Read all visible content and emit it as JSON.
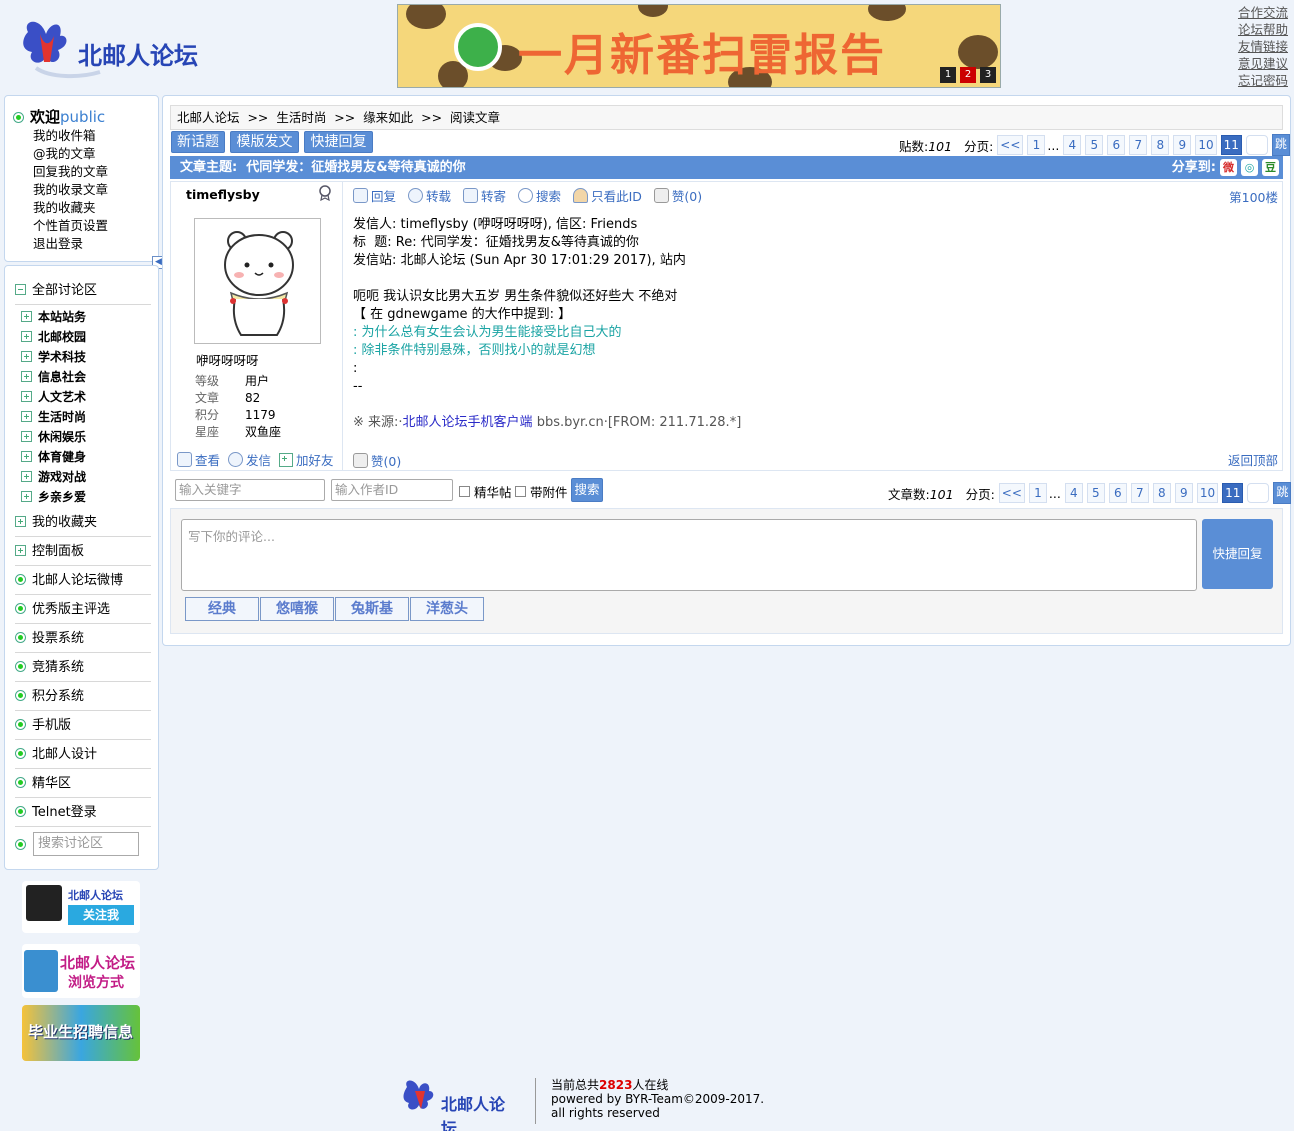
{
  "header": {
    "logo_text": "北邮人论坛",
    "banner_text": "一月新番扫雷报告",
    "banner_pages": [
      "1",
      "2",
      "3"
    ],
    "top_links": [
      "合作交流",
      "论坛帮助",
      "友情链接",
      "意见建议",
      "忘记密码"
    ]
  },
  "welcome": {
    "greeting": "欢迎",
    "user": "public",
    "links": [
      "我的收件箱",
      "@我的文章",
      "回复我的文章",
      "我的收录文章",
      "我的收藏夹",
      "个性首页设置",
      "退出登录"
    ]
  },
  "nav": {
    "all_sections": "全部讨论区",
    "sections": [
      "本站站务",
      "北邮校园",
      "学术科技",
      "信息社会",
      "人文艺术",
      "生活时尚",
      "休闲娱乐",
      "体育健身",
      "游戏对战",
      "乡亲乡爱"
    ],
    "favorites": "我的收藏夹",
    "control_panel": "控制面板",
    "items": [
      "北邮人论坛微博",
      "优秀版主评选",
      "投票系统",
      "竞猜系统",
      "积分系统",
      "手机版",
      "北邮人设计",
      "精华区",
      "Telnet登录"
    ],
    "search_placeholder": "搜索讨论区"
  },
  "side_images": {
    "follow_title": "北邮人论坛",
    "follow_button": "关注我",
    "browse_title": "北邮人论坛",
    "browse_sub": "浏览方式",
    "jobs": "毕业生招聘信息"
  },
  "crumb": "北邮人论坛  >>  生活时尚  >>  缘来如此  >>  阅读文章",
  "actions": {
    "new_topic": "新话题",
    "template_post": "模版发文",
    "quick_reply": "快捷回复"
  },
  "pager": {
    "posts_label": "贴数:",
    "posts_count": "101",
    "articles_label": "文章数:",
    "articles_count": "101",
    "page_label": "分页:",
    "prev": "<<",
    "pages": [
      "1",
      "...",
      "4",
      "5",
      "6",
      "7",
      "8",
      "9",
      "10",
      "11"
    ],
    "current": "11",
    "go": "跳"
  },
  "topic": {
    "label": "文章主题:",
    "title": "代同学发：征婚找男友&等待真诚的你",
    "share_label": "分享到:"
  },
  "author": {
    "id": "timeflysby",
    "nickname": "咿呀呀呀呀",
    "fields": [
      {
        "k": "等级",
        "v": "用户"
      },
      {
        "k": "文章",
        "v": "82"
      },
      {
        "k": "积分",
        "v": "1179"
      },
      {
        "k": "星座",
        "v": "双鱼座"
      }
    ],
    "actions": [
      "查看",
      "发信",
      "加好友"
    ]
  },
  "post": {
    "toolbar": [
      "回复",
      "转载",
      "转寄",
      "搜索",
      "只看此ID",
      "赞(0)"
    ],
    "floor": "第100楼",
    "header_lines": [
      "发信人: timeflysby (咿呀呀呀呀), 信区: Friends",
      "标  题: Re: 代同学发：征婚找男友&等待真诚的你",
      "发信站: 北邮人论坛 (Sun Apr 30 17:01:29 2017), 站内"
    ],
    "text": "呃呃 我认识女比男大五岁 男生条件貌似还好些大 不绝对",
    "quote_head": "【 在 gdnewgame 的大作中提到: 】",
    "quote_lines": [
      ": 为什么总有女生会认为男生能接受比自己大的",
      ": 除非条件特别悬殊，否则找小的就是幻想",
      ":"
    ],
    "sig_sep": "--",
    "source_prefix": "※ 来源:·",
    "source_link": "北邮人论坛手机客户端",
    "source_suffix": " bbs.byr.cn·[FROM: 211.71.28.*]",
    "like": "赞(0)",
    "back_top": "返回顶部"
  },
  "filter": {
    "keyword_placeholder": "输入关键字",
    "author_placeholder": "输入作者ID",
    "essence": "精华帖",
    "attachment": "带附件",
    "search": "搜索"
  },
  "reply": {
    "placeholder": "写下你的评论...",
    "submit": "快捷回复",
    "emoticons": [
      "经典",
      "悠嘻猴",
      "兔斯基",
      "洋葱头"
    ]
  },
  "footer": {
    "online_prefix": "当前总共",
    "online_count": "2823",
    "online_suffix": "人在线",
    "powered": "powered by BYR-Team©2009-2017.",
    "rights": "all rights reserved"
  }
}
